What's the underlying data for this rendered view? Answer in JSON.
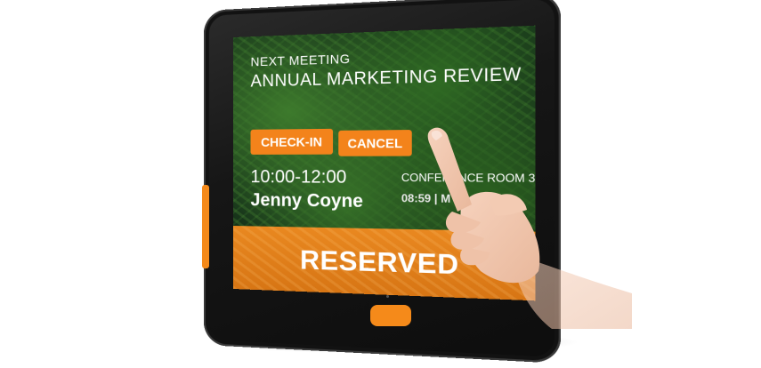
{
  "screen": {
    "next_meeting_label": "NEXT MEETING",
    "meeting_title": "ANNUAL MARKETING REVIEW",
    "checkin_label": "CHECK-IN",
    "cancel_label": "CANCEL",
    "time_range": "10:00-12:00",
    "organizer": "Jenny Coyne",
    "room_name": "CONFERENCE ROOM 3",
    "clock": "08:59 | M",
    "status_banner": "RESERVED"
  },
  "colors": {
    "accent": "#f3831b",
    "bezel": "#151515",
    "screen_bg": "#17341a"
  },
  "icons": [
    "hand-pointer"
  ]
}
